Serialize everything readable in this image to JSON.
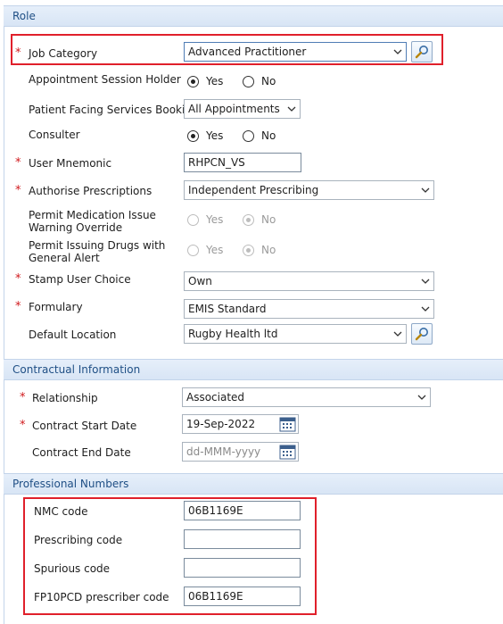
{
  "sections": {
    "role": "Role",
    "contractual": "Contractual Information",
    "professional": "Professional Numbers"
  },
  "required_mark": "*",
  "role": {
    "job_category": {
      "label": "Job Category",
      "value": "Advanced Practitioner"
    },
    "appointment_session_holder": {
      "label": "Appointment Session Holder",
      "yes": "Yes",
      "no": "No",
      "selected": "Yes"
    },
    "patient_facing_booking": {
      "label": "Patient Facing Services Booking",
      "value": "All Appointments"
    },
    "consulter": {
      "label": "Consulter",
      "yes": "Yes",
      "no": "No",
      "selected": "Yes"
    },
    "user_mnemonic": {
      "label": "User Mnemonic",
      "value": "RHPCN_VS"
    },
    "authorise_prescriptions": {
      "label": "Authorise Prescriptions",
      "value": "Independent Prescribing"
    },
    "permit_medication_issue": {
      "label": "Permit Medication Issue Warning Override",
      "yes": "Yes",
      "no": "No",
      "selected": "No"
    },
    "permit_issuing_drugs": {
      "label": "Permit Issuing Drugs with General Alert",
      "yes": "Yes",
      "no": "No",
      "selected": "No"
    },
    "stamp_user_choice": {
      "label": "Stamp User Choice",
      "value": "Own"
    },
    "formulary": {
      "label": "Formulary",
      "value": "EMIS Standard"
    },
    "default_location": {
      "label": "Default Location",
      "value": "Rugby Health ltd"
    }
  },
  "contractual": {
    "relationship": {
      "label": "Relationship",
      "value": "Associated"
    },
    "contract_start_date": {
      "label": "Contract Start Date",
      "value": "19-Sep-2022"
    },
    "contract_end_date": {
      "label": "Contract End Date",
      "placeholder": "dd-MMM-yyyy"
    }
  },
  "professional": {
    "nmc_code": {
      "label": "NMC code",
      "value": "06B1169E"
    },
    "prescribing_code": {
      "label": "Prescribing code",
      "value": ""
    },
    "spurious_code": {
      "label": "Spurious code",
      "value": ""
    },
    "fp10pcd_code": {
      "label": "FP10PCD prescriber code",
      "value": "06B1169E"
    }
  },
  "colors": {
    "section_header_text": "#1f4f85",
    "required": "#d0181c",
    "highlight_box": "#e0202b"
  }
}
